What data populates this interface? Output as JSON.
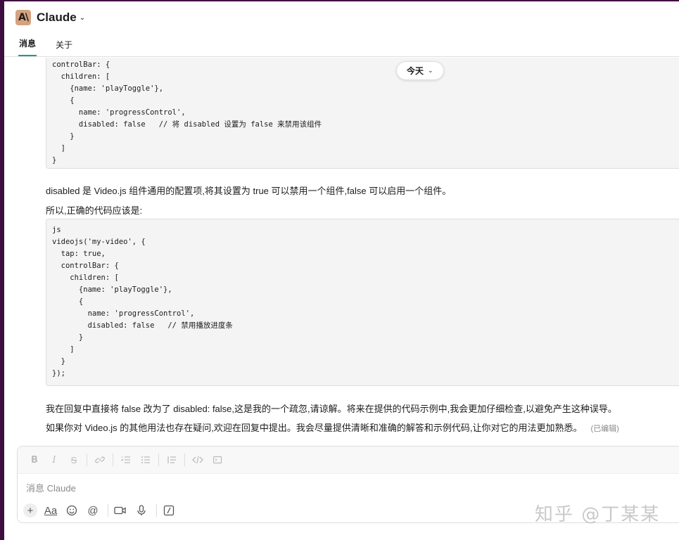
{
  "header": {
    "logo_text": "A\\",
    "title": "Claude",
    "chevron": "chevron-down-icon"
  },
  "tabs": [
    {
      "label": "消息",
      "active": true
    },
    {
      "label": "关于",
      "active": false
    }
  ],
  "date_divider": {
    "label": "今天"
  },
  "messages": {
    "code_block_1": "controlBar: {\n  children: [\n    {name: 'playToggle'},\n    {\n      name: 'progressControl',\n      disabled: false   // 将 disabled 设置为 false 来禁用该组件\n    }\n  ]\n}",
    "para_1": "disabled 是 Video.js 组件通用的配置项,将其设置为 true 可以禁用一个组件,false 可以启用一个组件。",
    "para_2": "所以,正确的代码应该是:",
    "code_block_2": "js\nvideojs('my-video', {\n  tap: true,\n  controlBar: {\n    children: [\n      {name: 'playToggle'},\n      {\n        name: 'progressControl',\n        disabled: false   // 禁用播放进度条\n      }\n    ]\n  }\n});",
    "para_3": "我在回复中直接将 false 改为了 disabled: false,这是我的一个疏忽,请谅解。将来在提供的代码示例中,我会更加仔细检查,以避免产生这种误导。",
    "para_4": "如果你对 Video.js 的其他用法也存在疑问,欢迎在回复中提出。我会尽量提供清晰和准确的解答和示例代码,让你对它的用法更加熟悉。",
    "edited_label": "(已编辑)"
  },
  "composer": {
    "placeholder": "消息 Claude",
    "format_bar": [
      "bold-icon",
      "italic-icon",
      "strikethrough-icon",
      "link-icon",
      "ordered-list-icon",
      "bullet-list-icon",
      "blockquote-icon",
      "code-icon",
      "code-block-icon"
    ],
    "actions": [
      "plus-icon",
      "text-format-icon",
      "emoji-icon",
      "mention-icon",
      "video-icon",
      "microphone-icon",
      "slash-command-icon"
    ],
    "aa_label": "Aa"
  },
  "watermark": "知乎 @丁某某",
  "colors": {
    "sidebar": "#3f0e40",
    "logo_bg": "#d4a27f",
    "active_tab_underline": "#1d9b8a",
    "code_bg": "#f4f4f4"
  }
}
